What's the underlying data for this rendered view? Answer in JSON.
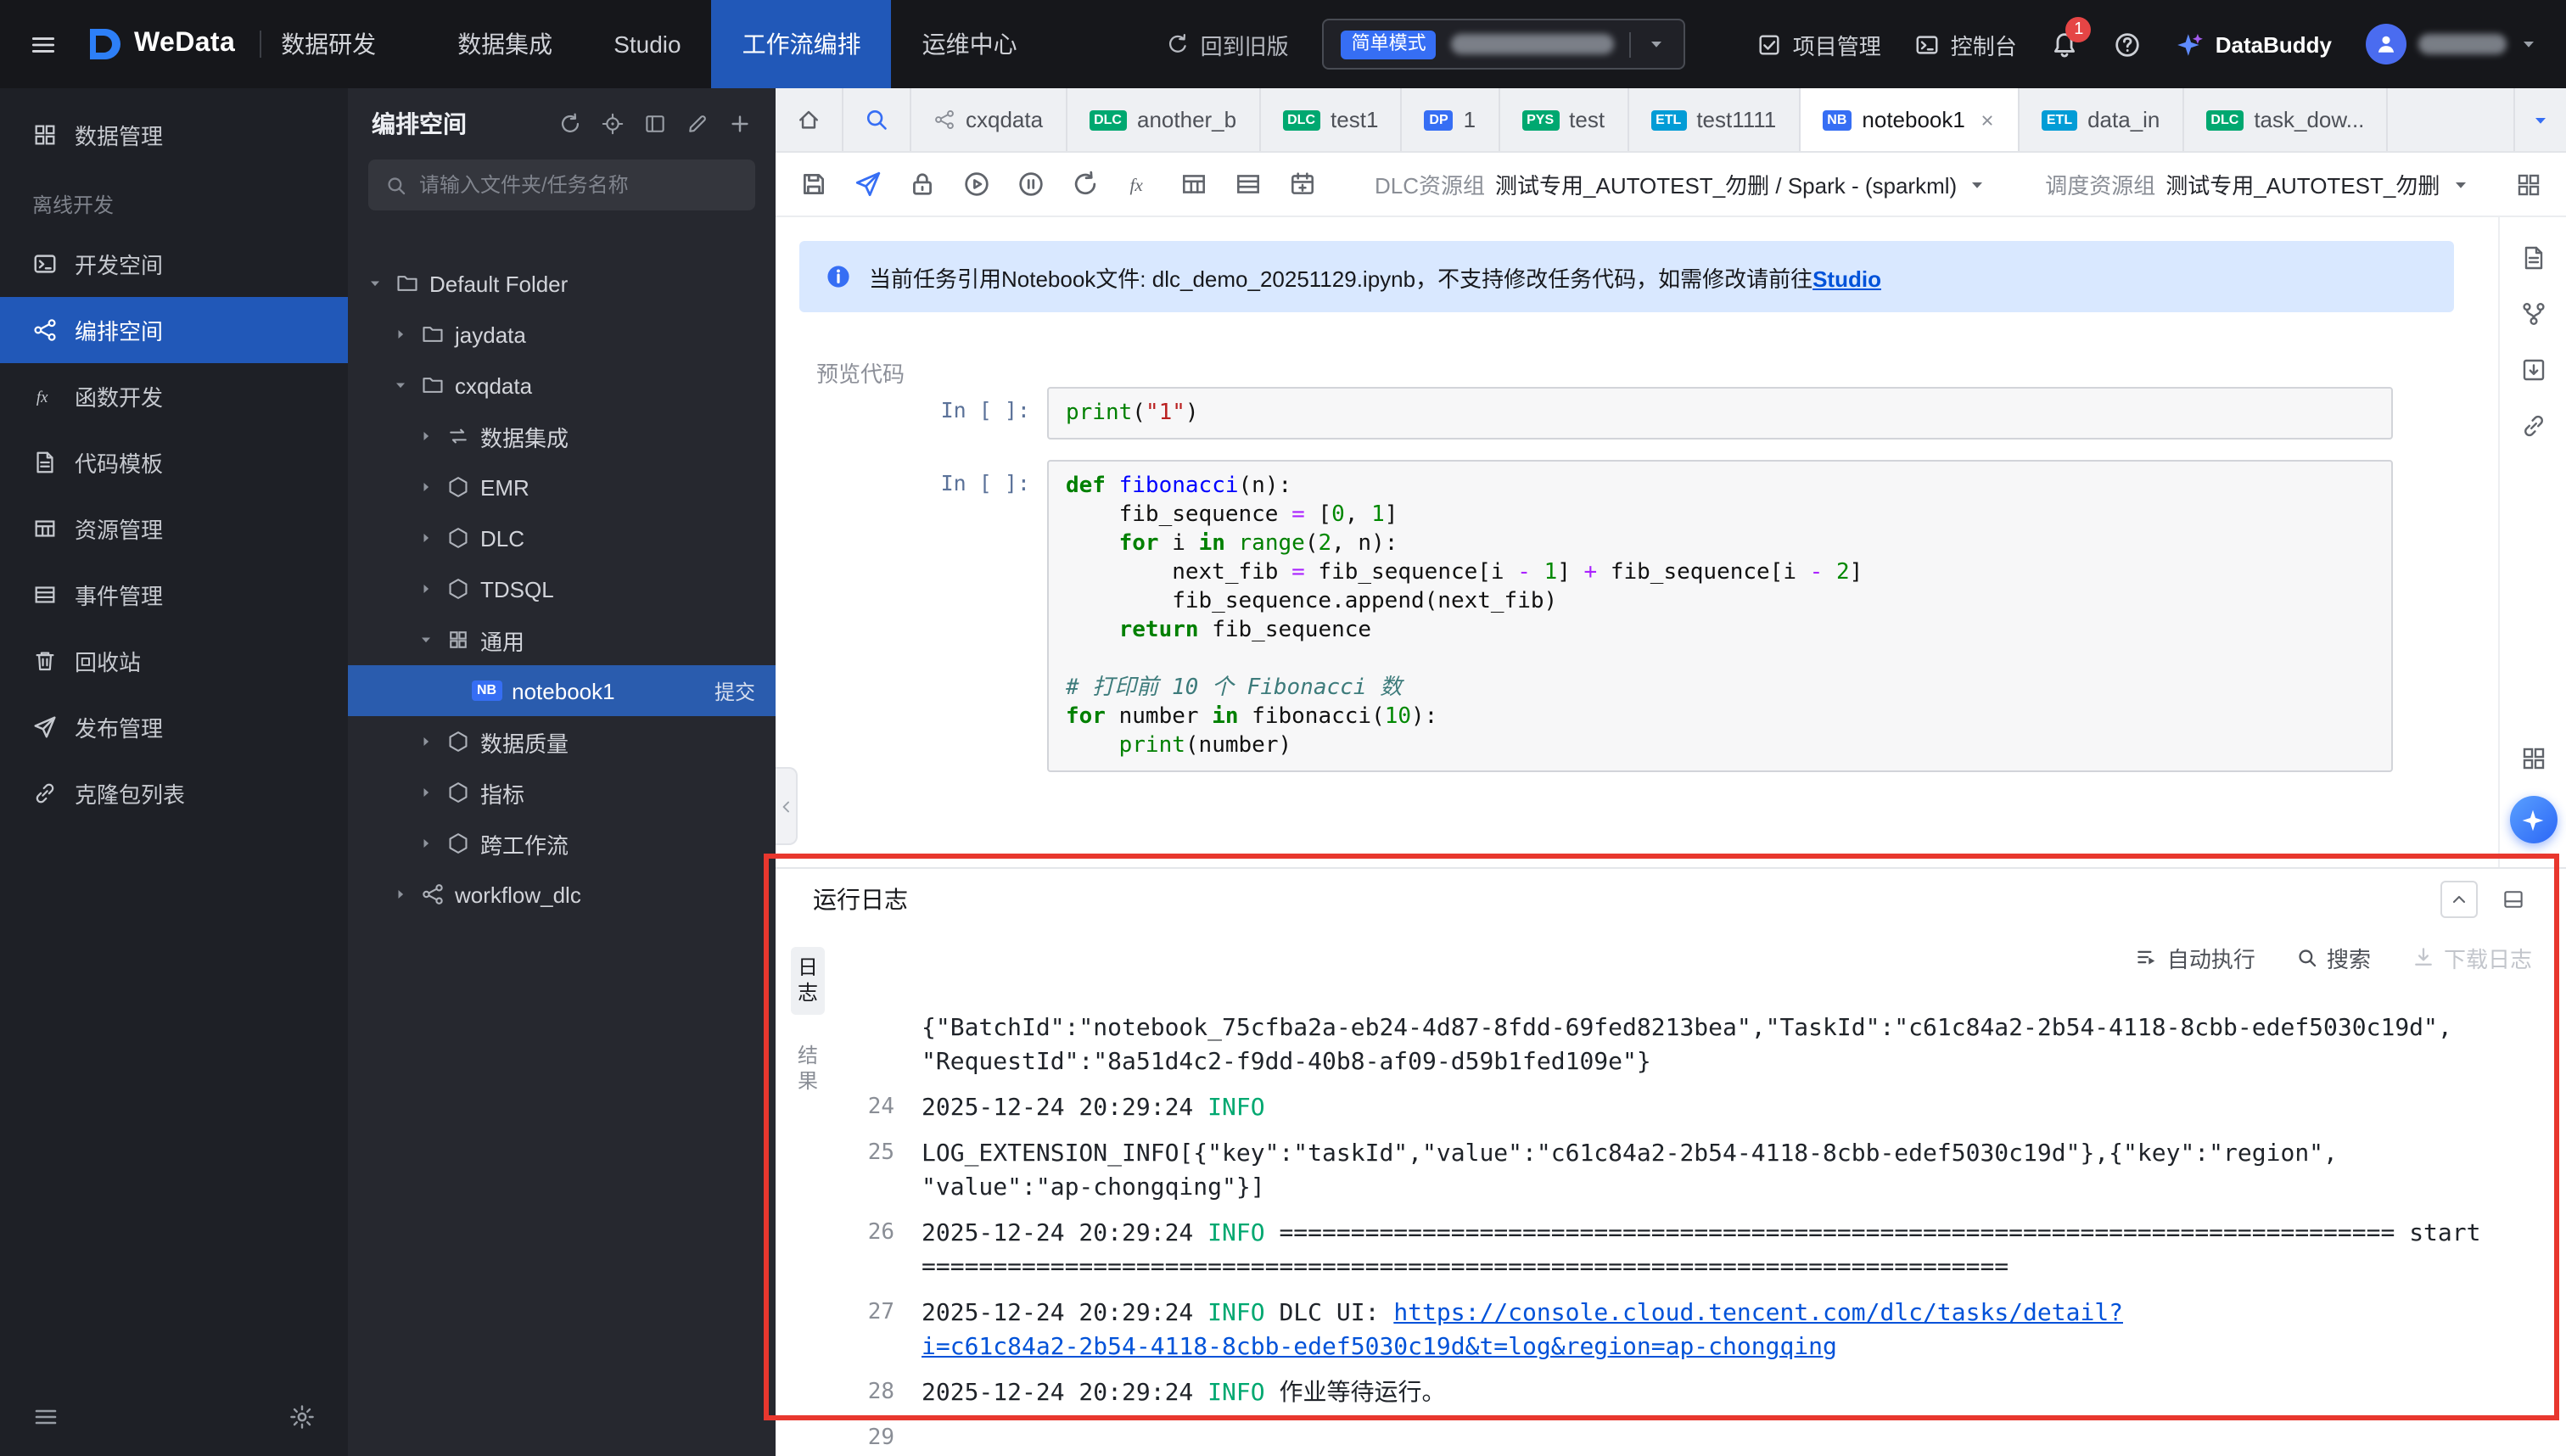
{
  "topbar": {
    "logo": "WeData",
    "suite": "数据研发",
    "nav": [
      {
        "label": "数据集成",
        "active": false
      },
      {
        "label": "Studio",
        "active": false
      },
      {
        "label": "工作流编排",
        "active": true
      },
      {
        "label": "运维中心",
        "active": false
      }
    ],
    "back_label": "回到旧版",
    "mode_badge": "简单模式",
    "project_label": "项目管理",
    "console_label": "控制台",
    "notification_count": "1",
    "buddy_label": "DataBuddy"
  },
  "leftnav": {
    "items": [
      {
        "label": "数据管理",
        "icon": "data-manage",
        "kind": "item",
        "active": false
      },
      {
        "label": "离线开发",
        "kind": "section"
      },
      {
        "label": "开发空间",
        "icon": "dev-space",
        "kind": "item",
        "active": false
      },
      {
        "label": "编排空间",
        "icon": "orchestrate",
        "kind": "item",
        "active": true
      },
      {
        "label": "函数开发",
        "icon": "function",
        "kind": "item",
        "active": false
      },
      {
        "label": "代码模板",
        "icon": "template",
        "kind": "item",
        "active": false
      },
      {
        "label": "资源管理",
        "icon": "resource",
        "kind": "item",
        "active": false
      },
      {
        "label": "事件管理",
        "icon": "event",
        "kind": "item",
        "active": false
      },
      {
        "label": "回收站",
        "icon": "trash",
        "kind": "item",
        "active": false
      },
      {
        "label": "发布管理",
        "icon": "publish",
        "kind": "item",
        "active": false
      },
      {
        "label": "克隆包列表",
        "icon": "clone",
        "kind": "item",
        "active": false
      }
    ]
  },
  "tree": {
    "title": "编排空间",
    "search_placeholder": "请输入文件夹/任务名称",
    "nodes": [
      {
        "label": "Default Folder",
        "depth": 0,
        "arrow": "down",
        "icon": "folder"
      },
      {
        "label": "jaydata",
        "depth": 1,
        "arrow": "right",
        "icon": "folder"
      },
      {
        "label": "cxqdata",
        "depth": 1,
        "arrow": "down",
        "icon": "folder"
      },
      {
        "label": "数据集成",
        "depth": 2,
        "arrow": "right",
        "icon": "sync"
      },
      {
        "label": "EMR",
        "depth": 2,
        "arrow": "right",
        "icon": "hex"
      },
      {
        "label": "DLC",
        "depth": 2,
        "arrow": "right",
        "icon": "hex"
      },
      {
        "label": "TDSQL",
        "depth": 2,
        "arrow": "right",
        "icon": "hex"
      },
      {
        "label": "通用",
        "depth": 2,
        "arrow": "down",
        "icon": "grid4"
      },
      {
        "label": "notebook1",
        "depth": 3,
        "arrow": "none",
        "icon": "nb",
        "badge": "NB",
        "selected": true,
        "action": "提交"
      },
      {
        "label": "数据质量",
        "depth": 2,
        "arrow": "right",
        "icon": "hex"
      },
      {
        "label": "指标",
        "depth": 2,
        "arrow": "right",
        "icon": "hex"
      },
      {
        "label": "跨工作流",
        "depth": 2,
        "arrow": "right",
        "icon": "hex"
      },
      {
        "label": "workflow_dlc",
        "depth": 1,
        "arrow": "right",
        "icon": "share"
      }
    ]
  },
  "tabs": [
    {
      "kind": "icon",
      "icon": "home"
    },
    {
      "kind": "icon",
      "icon": "search",
      "accent": true
    },
    {
      "label": "cxqdata",
      "icon": "share"
    },
    {
      "label": "another_b",
      "badge": "DLC",
      "badge_color": "#00a870"
    },
    {
      "label": "test1",
      "badge": "DLC",
      "badge_color": "#00a870"
    },
    {
      "label": "1",
      "badge": "DP",
      "badge_color": "#366ef4"
    },
    {
      "label": "test",
      "badge": "PYS",
      "badge_color": "#00a870"
    },
    {
      "label": "test1111",
      "badge": "ETL",
      "badge_color": "#029cd6"
    },
    {
      "label": "notebook1",
      "badge": "NB",
      "badge_color": "#366ef4",
      "active": true,
      "closable": true
    },
    {
      "label": "data_in",
      "badge": "ETL",
      "badge_color": "#029cd6"
    },
    {
      "label": "task_dow...",
      "badge": "DLC",
      "badge_color": "#00a870"
    }
  ],
  "toolbar": {
    "icons": [
      "save",
      "send",
      "lock",
      "play-circle",
      "pause-circle",
      "refresh",
      "fx",
      "table",
      "rows",
      "cal-plus"
    ],
    "dlc_group_label": "DLC资源组",
    "dlc_group_value": "测试专用_AUTOTEST_勿删 / Spark - (sparkml)",
    "sched_group_label": "调度资源组",
    "sched_group_value": "测试专用_AUTOTEST_勿删"
  },
  "banner": {
    "text": "当前任务引用Notebook文件: dlc_demo_20251129.ipynb，不支持修改任务代码，如需修改请前往",
    "link": "Studio"
  },
  "preview_label": "预览代码",
  "notebook": {
    "prompt": "In [ ]:",
    "cells": [
      {
        "lines": [
          [
            {
              "t": "bi",
              "v": "print"
            },
            {
              "t": "p",
              "v": "("
            },
            {
              "t": "s",
              "v": "\"1\""
            },
            {
              "t": "p",
              "v": ")"
            }
          ]
        ]
      },
      {
        "lines": [
          [
            {
              "t": "kw",
              "v": "def"
            },
            {
              "t": "p",
              "v": " "
            },
            {
              "t": "fn",
              "v": "fibonacci"
            },
            {
              "t": "p",
              "v": "(n):"
            }
          ],
          [
            {
              "t": "p",
              "v": "    fib_sequence "
            },
            {
              "t": "op",
              "v": "="
            },
            {
              "t": "p",
              "v": " ["
            },
            {
              "t": "n",
              "v": "0"
            },
            {
              "t": "p",
              "v": ", "
            },
            {
              "t": "n",
              "v": "1"
            },
            {
              "t": "p",
              "v": "]"
            }
          ],
          [
            {
              "t": "p",
              "v": "    "
            },
            {
              "t": "kw",
              "v": "for"
            },
            {
              "t": "p",
              "v": " i "
            },
            {
              "t": "kw",
              "v": "in"
            },
            {
              "t": "p",
              "v": " "
            },
            {
              "t": "bi",
              "v": "range"
            },
            {
              "t": "p",
              "v": "("
            },
            {
              "t": "n",
              "v": "2"
            },
            {
              "t": "p",
              "v": ", n):"
            }
          ],
          [
            {
              "t": "p",
              "v": "        next_fib "
            },
            {
              "t": "op",
              "v": "="
            },
            {
              "t": "p",
              "v": " fib_sequence[i "
            },
            {
              "t": "op",
              "v": "-"
            },
            {
              "t": "p",
              "v": " "
            },
            {
              "t": "n",
              "v": "1"
            },
            {
              "t": "p",
              "v": "] "
            },
            {
              "t": "op",
              "v": "+"
            },
            {
              "t": "p",
              "v": " fib_sequence[i "
            },
            {
              "t": "op",
              "v": "-"
            },
            {
              "t": "p",
              "v": " "
            },
            {
              "t": "n",
              "v": "2"
            },
            {
              "t": "p",
              "v": "]"
            }
          ],
          [
            {
              "t": "p",
              "v": "        fib_sequence.append(next_fib)"
            }
          ],
          [
            {
              "t": "p",
              "v": "    "
            },
            {
              "t": "kw",
              "v": "return"
            },
            {
              "t": "p",
              "v": " fib_sequence"
            }
          ],
          [],
          [
            {
              "t": "c",
              "v": "# 打印前 10 个 Fibonacci 数"
            }
          ],
          [
            {
              "t": "kw",
              "v": "for"
            },
            {
              "t": "p",
              "v": " number "
            },
            {
              "t": "kw",
              "v": "in"
            },
            {
              "t": "p",
              "v": " fibonacci("
            },
            {
              "t": "n",
              "v": "10"
            },
            {
              "t": "p",
              "v": "):"
            }
          ],
          [
            {
              "t": "p",
              "v": "    "
            },
            {
              "t": "bi",
              "v": "print"
            },
            {
              "t": "p",
              "v": "(number)"
            }
          ]
        ]
      }
    ]
  },
  "log_panel": {
    "title": "运行日志",
    "tabs": [
      {
        "label": "日志",
        "active": true
      },
      {
        "label": "结果",
        "active": false
      }
    ],
    "actions": {
      "auto": "自动执行",
      "search": "搜索",
      "download": "下载日志"
    },
    "entries": [
      {
        "num": "",
        "lines": [
          [
            {
              "t": "p",
              "v": "{\"BatchId\":\"notebook_75cfba2a-eb24-4d87-8fdd-69fed8213bea\",\"TaskId\":\"c61c84a2-2b54-4118-8cbb-edef5030c19d\","
            }
          ],
          [
            {
              "t": "p",
              "v": "\"RequestId\":\"8a51d4c2-f9dd-40b8-af09-d59b1fed109e\"}"
            }
          ]
        ]
      },
      {
        "num": "24",
        "lines": [
          [
            {
              "t": "p",
              "v": "2025-12-24 20:29:24 "
            },
            {
              "t": "info",
              "v": "INFO"
            }
          ]
        ]
      },
      {
        "num": "25",
        "lines": [
          [
            {
              "t": "p",
              "v": "LOG_EXTENSION_INFO[{\"key\":\"taskId\",\"value\":\"c61c84a2-2b54-4118-8cbb-edef5030c19d\"},{\"key\":\"region\","
            }
          ],
          [
            {
              "t": "p",
              "v": "\"value\":\"ap-chongqing\"}]"
            }
          ]
        ]
      },
      {
        "num": "26",
        "lines": [
          [
            {
              "t": "p",
              "v": "2025-12-24 20:29:24 "
            },
            {
              "t": "info",
              "v": "INFO"
            },
            {
              "t": "p",
              "v": " ============================================================================== start"
            }
          ],
          [
            {
              "t": "p",
              "v": "============================================================================"
            }
          ]
        ]
      },
      {
        "num": "27",
        "lines": [
          [
            {
              "t": "p",
              "v": "2025-12-24 20:29:24 "
            },
            {
              "t": "info",
              "v": "INFO"
            },
            {
              "t": "p",
              "v": " DLC UI: "
            },
            {
              "t": "link",
              "v": "https://console.cloud.tencent.com/dlc/tasks/detail?"
            }
          ],
          [
            {
              "t": "link",
              "v": "i=c61c84a2-2b54-4118-8cbb-edef5030c19d&t=log&region=ap-chongqing"
            }
          ]
        ]
      },
      {
        "num": "28",
        "lines": [
          [
            {
              "t": "p",
              "v": "2025-12-24 20:29:24 "
            },
            {
              "t": "info",
              "v": "INFO"
            },
            {
              "t": "p",
              "v": " 作业等待运行。"
            }
          ]
        ]
      },
      {
        "num": "29",
        "lines": [
          []
        ]
      }
    ]
  }
}
